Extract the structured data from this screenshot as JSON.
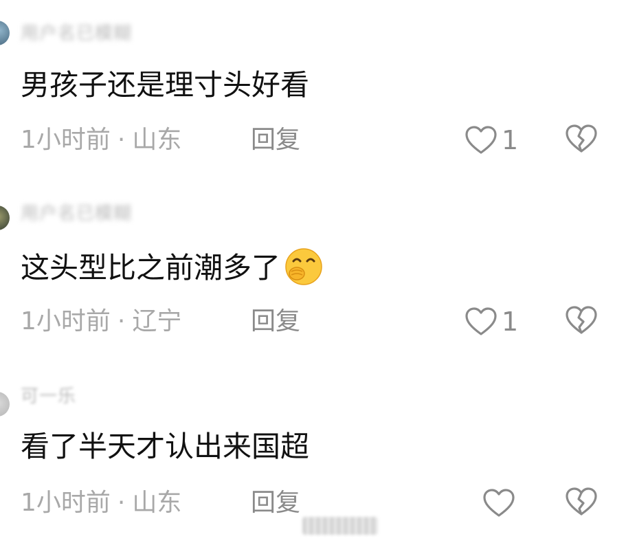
{
  "comments": [
    {
      "username": "用户名已模糊",
      "text": "男孩子还是理寸头好看",
      "time": "1小时前",
      "location": "山东",
      "reply_label": "回复",
      "likes": "1"
    },
    {
      "username": "用户名已模糊",
      "text": "这头型比之前潮多了",
      "emoji": "smiling-face-with-hand-over-mouth",
      "time": "1小时前",
      "location": "辽宁",
      "reply_label": "回复",
      "likes": "1"
    },
    {
      "username": "可一乐",
      "text": "看了半天才认出来国超",
      "time": "1小时前",
      "location": "山东",
      "reply_label": "回复",
      "likes": ""
    }
  ],
  "separator": "·",
  "colors": {
    "text": "#111111",
    "meta": "#a8a8a8",
    "icon": "#8a8a8a",
    "background": "#ffffff"
  }
}
